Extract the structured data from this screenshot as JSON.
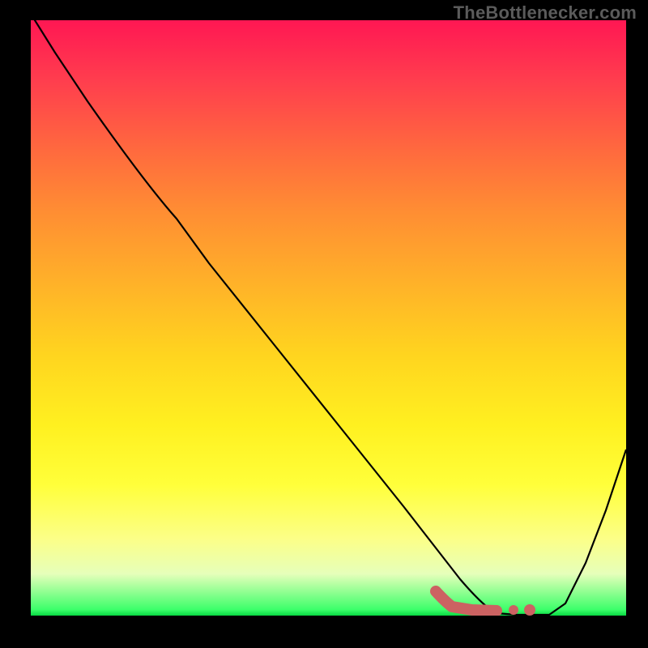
{
  "watermark": {
    "text": "TheBottlenecker.com"
  },
  "colors": {
    "frame": "#000000",
    "curve": "#000000",
    "marker": "#cc6262",
    "gradient_top": "#ff1753",
    "gradient_bottom": "#08da43"
  },
  "chart_data": {
    "type": "line",
    "x": [
      0.0,
      0.05,
      0.1,
      0.15,
      0.2,
      0.25,
      0.3,
      0.35,
      0.4,
      0.45,
      0.5,
      0.55,
      0.6,
      0.65,
      0.7,
      0.72,
      0.75,
      0.8,
      0.85,
      0.9,
      0.95,
      1.0
    ],
    "values": [
      100,
      92,
      85,
      79,
      74,
      66,
      57,
      48,
      39,
      30,
      22,
      14,
      8,
      3,
      1,
      0,
      0,
      0,
      4,
      12,
      22,
      33
    ],
    "title": "",
    "xlabel": "",
    "ylabel": "",
    "ylim": [
      0,
      100
    ],
    "marker": {
      "x": 0.72,
      "y": 0,
      "width": 0.1
    },
    "notes": "x is a normalized parameter (0–1, no tick labels shown); y is a 0–100 scale encoded by the background gradient (0 = green bottom, 100 = red top). No numeric axis ticks are visible."
  }
}
